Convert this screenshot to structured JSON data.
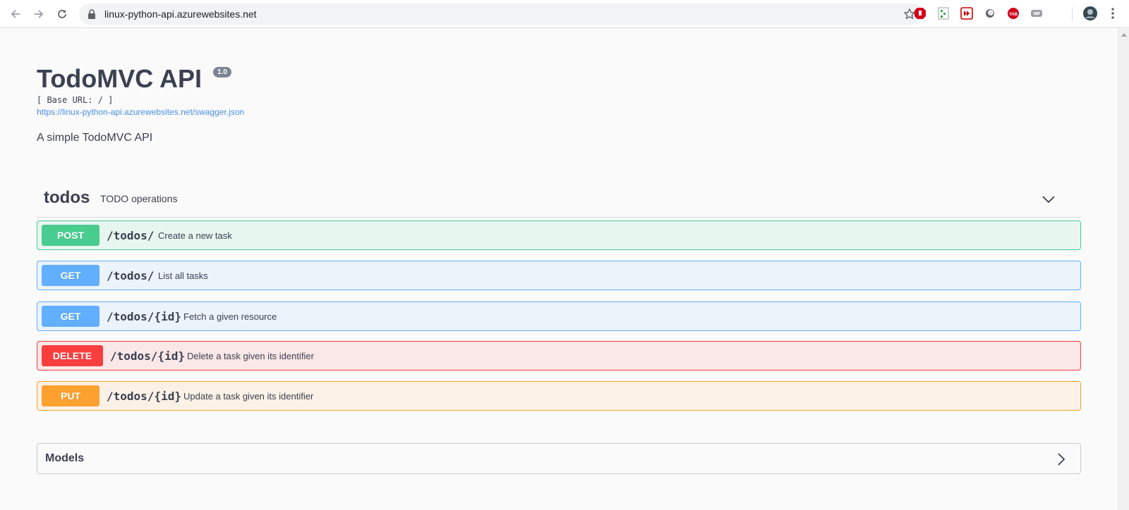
{
  "browser": {
    "url": "linux-python-api.azurewebsites.net",
    "extensions": [
      "adblock-icon",
      "sheets-extension-icon",
      "video-speed-icon",
      "dark-mode-icon",
      "yandex-icon",
      "infinity-icon"
    ]
  },
  "info": {
    "title": "TodoMVC API",
    "version": "1.0",
    "base_url": "[ Base URL: / ]",
    "spec_link": "https://linux-python-api.azurewebsites.net/swagger.json",
    "description": "A simple TodoMVC API"
  },
  "tag": {
    "name": "todos",
    "description": "TODO operations"
  },
  "operations": [
    {
      "method": "POST",
      "path": "/todos/",
      "summary": "Create a new task"
    },
    {
      "method": "GET",
      "path": "/todos/",
      "summary": "List all tasks"
    },
    {
      "method": "GET",
      "path": "/todos/{id}",
      "summary": "Fetch a given resource"
    },
    {
      "method": "DELETE",
      "path": "/todos/{id}",
      "summary": "Delete a task given its identifier"
    },
    {
      "method": "PUT",
      "path": "/todos/{id}",
      "summary": "Update a task given its identifier"
    }
  ],
  "models": {
    "label": "Models"
  },
  "colors": {
    "post": "#49cc90",
    "get": "#61affe",
    "delete": "#f93e3e",
    "put": "#fca130"
  }
}
